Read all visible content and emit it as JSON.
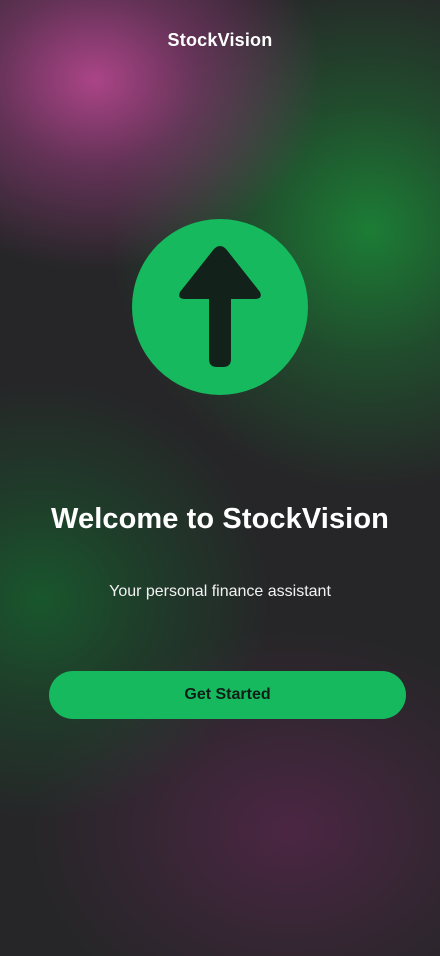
{
  "header": {
    "app_title": "StockVision"
  },
  "hero": {
    "logo_icon": "arrow-up-icon",
    "welcome_title": "Welcome to StockVision",
    "subtitle": "Your personal finance assistant"
  },
  "actions": {
    "get_started_label": "Get Started"
  },
  "colors": {
    "accent": "#16b95d",
    "arrow": "#13211b",
    "background": "#262628",
    "gradient_magenta": "#b2468c",
    "gradient_green": "#1a8c37",
    "gradient_plum": "#522648"
  }
}
